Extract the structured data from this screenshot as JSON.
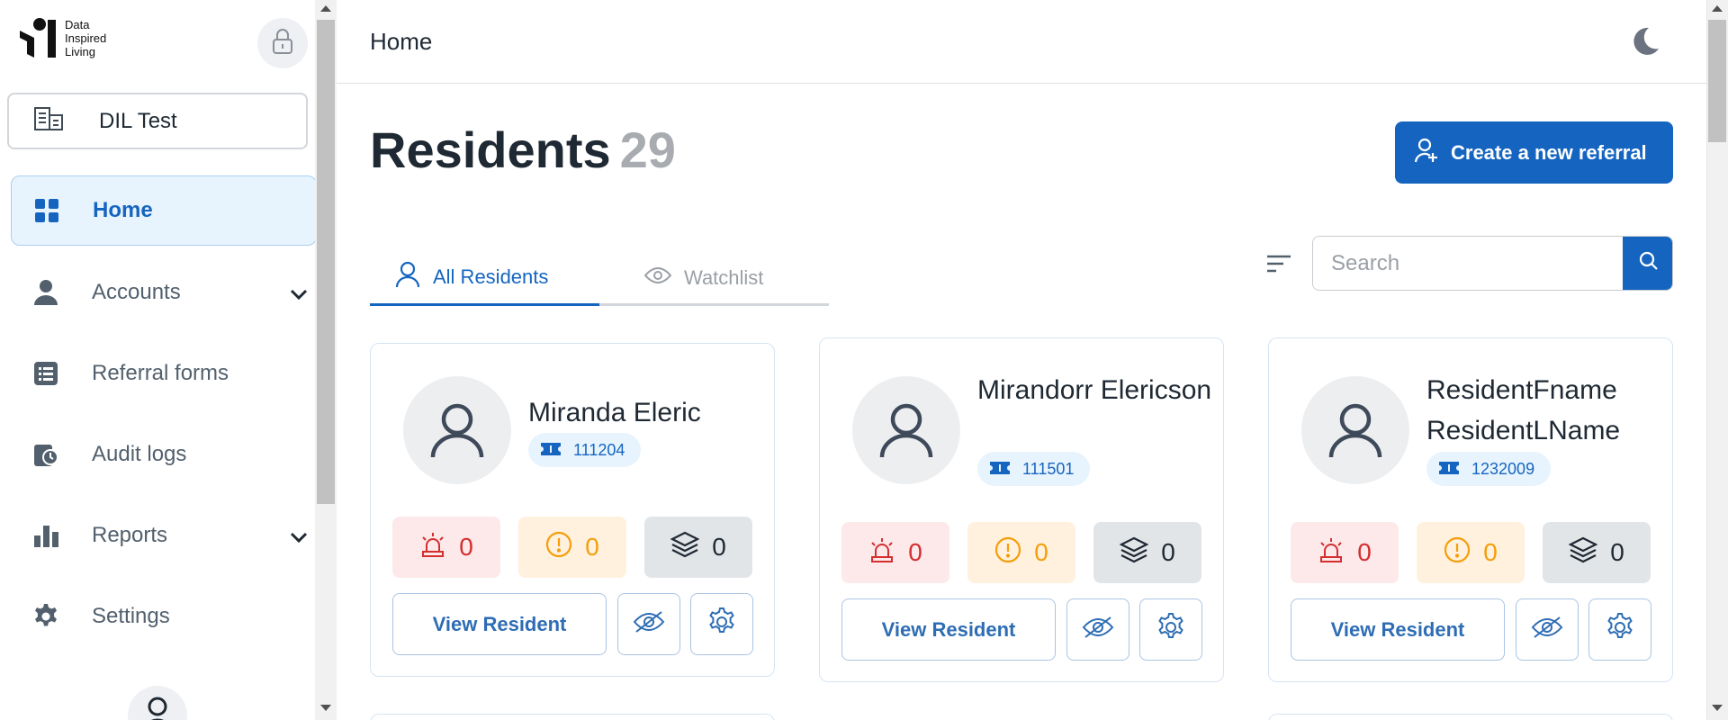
{
  "logo": {
    "line1": "Data",
    "line2": "Inspired",
    "line3": "Living"
  },
  "org": {
    "name": "DIL Test"
  },
  "nav": [
    {
      "label": "Home",
      "icon": "grid-icon",
      "active": true
    },
    {
      "label": "Accounts",
      "icon": "person-icon",
      "expandable": true
    },
    {
      "label": "Referral forms",
      "icon": "list-icon"
    },
    {
      "label": "Audit logs",
      "icon": "audit-icon"
    },
    {
      "label": "Reports",
      "icon": "bar-chart-icon",
      "expandable": true
    },
    {
      "label": "Settings",
      "icon": "gear-icon"
    }
  ],
  "header": {
    "title": "Home"
  },
  "page": {
    "title": "Residents",
    "count": "29"
  },
  "actions": {
    "create_label": "Create a new referral"
  },
  "tabs": [
    {
      "label": "All Residents",
      "active": true
    },
    {
      "label": "Watchlist"
    }
  ],
  "search": {
    "placeholder": "Search",
    "value": ""
  },
  "residents": [
    {
      "name": "Miranda Eleric",
      "id": "111204",
      "alerts": "0",
      "warnings": "0",
      "layers": "0",
      "view_label": "View Resident"
    },
    {
      "name": "Mirandorr Elericson",
      "id": "111501",
      "alerts": "0",
      "warnings": "0",
      "layers": "0",
      "view_label": "View Resident"
    },
    {
      "name": "ResidentFname ResidentLName",
      "id": "1232009",
      "alerts": "0",
      "warnings": "0",
      "layers": "0",
      "view_label": "View Resident"
    }
  ],
  "colors": {
    "primary": "#1565c0",
    "alert": "#d32f2f",
    "warning": "#f59e0b",
    "active_bg": "#e8f4fd"
  }
}
